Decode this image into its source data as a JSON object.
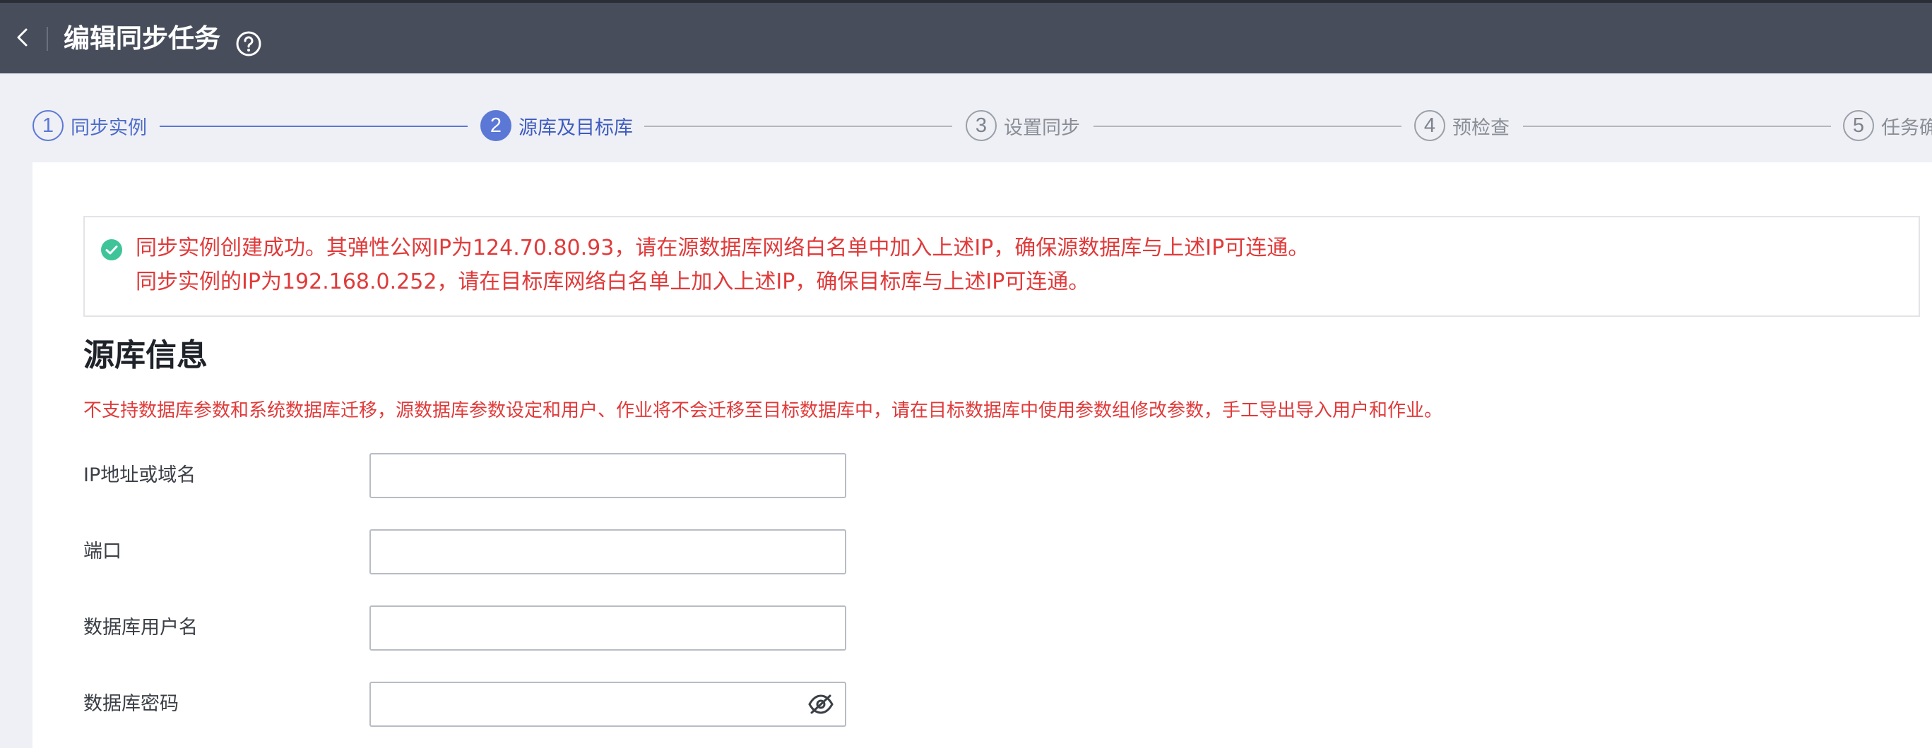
{
  "header": {
    "title": "编辑同步任务",
    "back_icon": "chevron-left-icon",
    "help_icon": "question-circle-icon"
  },
  "steps": [
    {
      "num": "1",
      "label": "同步实例",
      "state": "done"
    },
    {
      "num": "2",
      "label": "源库及目标库",
      "state": "active"
    },
    {
      "num": "3",
      "label": "设置同步",
      "state": "pending"
    },
    {
      "num": "4",
      "label": "预检查",
      "state": "pending"
    },
    {
      "num": "5",
      "label": "任务确",
      "state": "pending"
    }
  ],
  "notice": {
    "icon": "check-circle-icon",
    "line1": "同步实例创建成功。其弹性公网IP为124.70.80.93，请在源数据库网络白名单中加入上述IP，确保源数据库与上述IP可连通。",
    "line2": "同步实例的IP为192.168.0.252，请在目标库网络白名单上加入上述IP，确保目标库与上述IP可连通。"
  },
  "source": {
    "title": "源库信息",
    "warning": "不支持数据库参数和系统数据库迁移，源数据库参数设定和用户、作业将不会迁移至目标数据库中，请在目标数据库中使用参数组修改参数，手工导出导入用户和作业。",
    "fields": {
      "ip": {
        "label": "IP地址或域名",
        "value": ""
      },
      "port": {
        "label": "端口",
        "value": ""
      },
      "user": {
        "label": "数据库用户名",
        "value": ""
      },
      "password": {
        "label": "数据库密码",
        "value": "",
        "icon": "eye-off-icon"
      }
    }
  },
  "colors": {
    "header_bg": "#474d5b",
    "accent": "#5b78d6",
    "error": "#e03a3a",
    "success": "#3fc49a"
  }
}
